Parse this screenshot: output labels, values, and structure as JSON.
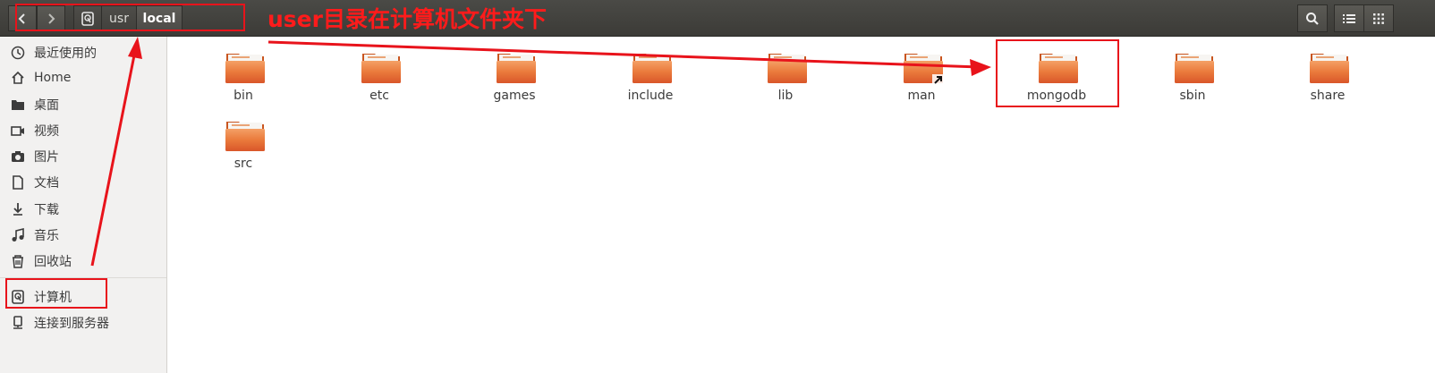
{
  "header": {
    "breadcrumbs": [
      "usr",
      "local"
    ],
    "annotation_text": "user目录在计算机文件夹下",
    "nav_back_icon": "chevron-left-icon",
    "nav_forward_icon": "chevron-right-icon"
  },
  "sidebar": {
    "items": [
      {
        "label": "最近使用的",
        "icon": "clock-icon"
      },
      {
        "label": "Home",
        "icon": "home-icon"
      },
      {
        "label": "桌面",
        "icon": "folder-icon"
      },
      {
        "label": "视频",
        "icon": "video-icon"
      },
      {
        "label": "图片",
        "icon": "camera-icon"
      },
      {
        "label": "文档",
        "icon": "document-icon"
      },
      {
        "label": "下载",
        "icon": "download-icon"
      },
      {
        "label": "音乐",
        "icon": "music-icon"
      },
      {
        "label": "回收站",
        "icon": "trash-icon"
      },
      {
        "label": "计算机",
        "icon": "computer-icon"
      },
      {
        "label": "连接到服务器",
        "icon": "server-icon"
      }
    ]
  },
  "files": [
    {
      "name": "bin"
    },
    {
      "name": "etc"
    },
    {
      "name": "games"
    },
    {
      "name": "include"
    },
    {
      "name": "lib"
    },
    {
      "name": "man",
      "link": true
    },
    {
      "name": "mongodb"
    },
    {
      "name": "sbin"
    },
    {
      "name": "share"
    },
    {
      "name": "src"
    }
  ],
  "colors": {
    "annotation": "#e8131b",
    "folder": "#e8753a",
    "header": "#3c3b37"
  }
}
